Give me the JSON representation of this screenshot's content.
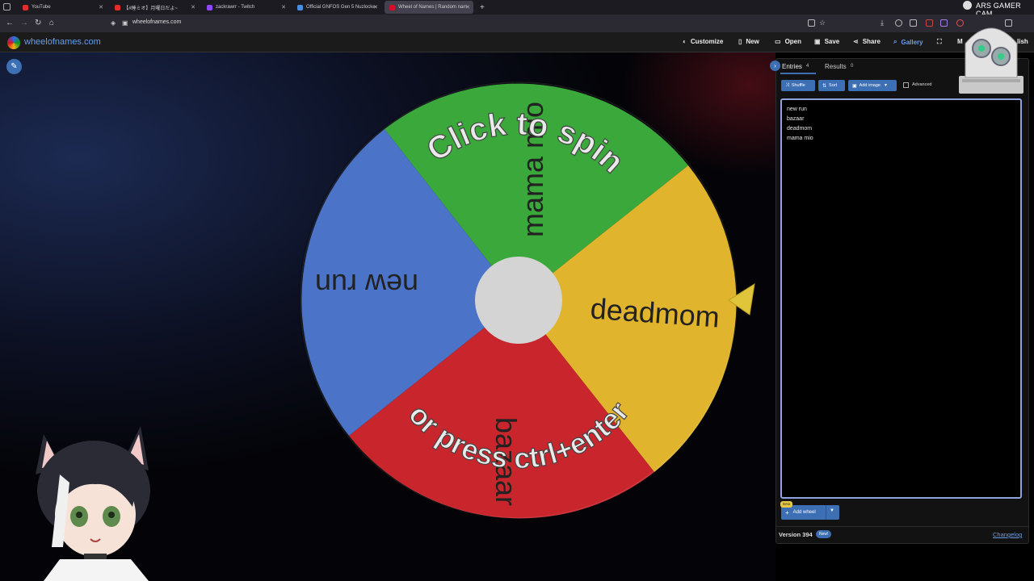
{
  "browser": {
    "tabs": [
      {
        "title": "YouTube",
        "color": "#e52d27",
        "active": false
      },
      {
        "title": "【#睡ミオ】月曜日だよ~",
        "color": "#e52d27",
        "active": false
      },
      {
        "title": "zackrawrr - Twitch",
        "color": "#9146ff",
        "active": false
      },
      {
        "title": "Official GNFOS Gen 5 Nuzlocke",
        "color": "#4a90e2",
        "active": false
      },
      {
        "title": "Wheel of Names | Random nam",
        "color": "#d50f25",
        "active": true
      }
    ],
    "new_tab": "+",
    "url": "wheelofnames.com"
  },
  "overlay": {
    "cam_label": "ARS GAMER CAM"
  },
  "app": {
    "site_name": "wheelofnames.com",
    "menu": [
      {
        "icon": "palette-icon",
        "glyph": "●",
        "label": "Customize"
      },
      {
        "icon": "new-file-icon",
        "glyph": "▌",
        "label": "New"
      },
      {
        "icon": "folder-icon",
        "glyph": "▬",
        "label": "Open"
      },
      {
        "icon": "save-icon",
        "glyph": "▪",
        "label": "Save"
      },
      {
        "icon": "share-icon",
        "glyph": "<",
        "label": "Share"
      },
      {
        "icon": "search-icon",
        "glyph": "⌕",
        "label": "Gallery"
      }
    ],
    "more_label_partial": "M",
    "lang_label_partial": "lish"
  },
  "wheel": {
    "slices": [
      {
        "label": "mama mio",
        "color": "#3aa83a"
      },
      {
        "label": "deadmom",
        "color": "#e0b52d"
      },
      {
        "label": "bazaar",
        "color": "#c9252c"
      },
      {
        "label": "new run",
        "color": "#4b74c9"
      }
    ],
    "prompt_top": "Click to spin",
    "prompt_bottom": "or press ctrl+enter",
    "pointer_color": "#e0c43a"
  },
  "panel": {
    "tabs": [
      {
        "label": "Entries",
        "count": "4"
      },
      {
        "label": "Results",
        "count": "0"
      }
    ],
    "buttons": {
      "shuffle": "Shuffle",
      "sort": "Sort",
      "add_image": "Add image"
    },
    "advanced_label": "Advanced",
    "entries": [
      "new run",
      "bazaar",
      "deadmom",
      "mama mio"
    ],
    "add_wheel": "Add wheel",
    "beta": "Beta",
    "version": "Version 394",
    "new_badge": "New!",
    "changelog": "Changelog"
  }
}
